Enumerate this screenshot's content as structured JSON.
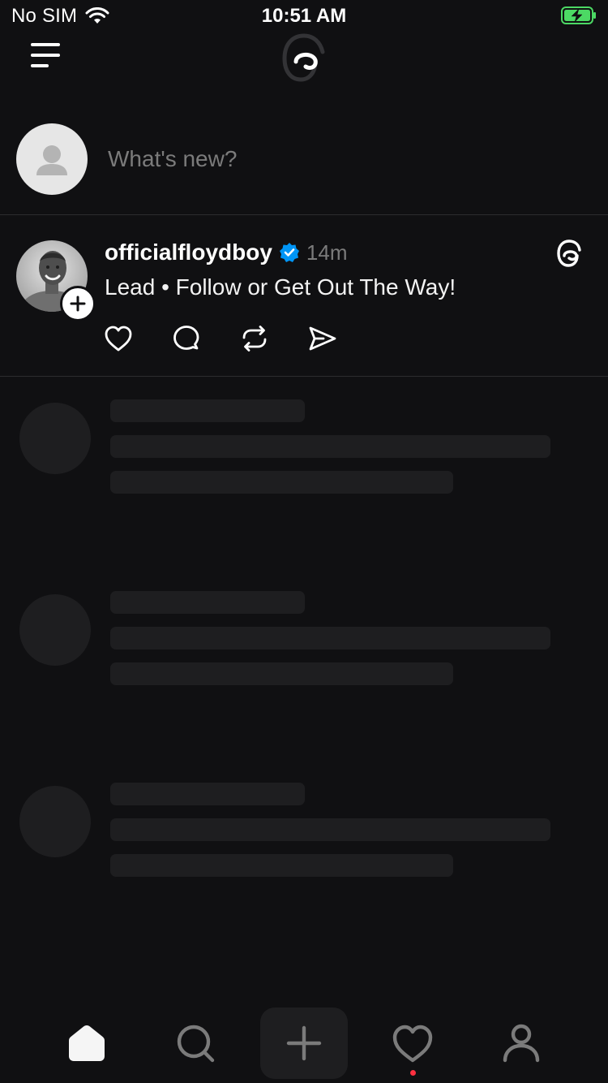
{
  "status_bar": {
    "carrier": "No SIM",
    "time": "10:51 AM",
    "battery_state": "charging",
    "battery_color": "#4cd964"
  },
  "header": {
    "menu_icon": "hamburger-menu-icon",
    "logo": "threads-logo"
  },
  "compose": {
    "placeholder": "What's new?"
  },
  "post": {
    "username": "officialfloydboy",
    "verified": true,
    "timestamp": "14m",
    "text": "Lead • Follow or Get Out The Way!",
    "actions": [
      "heart-icon",
      "comment-icon",
      "repost-icon",
      "share-icon"
    ]
  },
  "skeleton_rows": 3,
  "bottom_nav": {
    "items": [
      "home-icon",
      "search-icon",
      "plus-icon",
      "heart-icon",
      "profile-icon"
    ],
    "active": "home-icon",
    "notification_dot_color": "#ff3040"
  },
  "colors": {
    "background": "#101012",
    "muted_text": "#7b7b7b",
    "skeleton": "#1e1e20",
    "verified_blue": "#0095f6"
  }
}
